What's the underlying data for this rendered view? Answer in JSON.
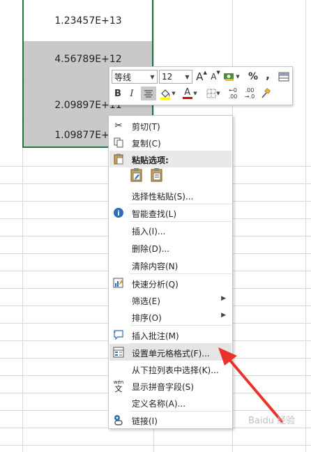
{
  "cells": [
    "1.23457E+13",
    "4.56789E+12",
    "2.09897E+11",
    "1.09877E+10"
  ],
  "toolbar": {
    "font_name": "等线",
    "font_size": "12",
    "grow_font": "A",
    "shrink_font": "A",
    "percent": "%",
    "comma": ",",
    "bold": "B",
    "italic": "I",
    "font_color_letter": "A",
    "decrease_decimal_top": "←0",
    "decrease_decimal_bottom": ".00",
    "increase_decimal_top": ".00",
    "increase_decimal_bottom": "→.0"
  },
  "menu": {
    "cut": "剪切(T)",
    "copy": "复制(C)",
    "paste_options": "粘贴选项:",
    "paste_special": "选择性粘贴(S)...",
    "smart_lookup": "智能查找(L)",
    "insert": "插入(I)...",
    "delete": "删除(D)...",
    "clear_contents": "清除内容(N)",
    "quick_analysis": "快速分析(Q)",
    "filter": "筛选(E)",
    "sort": "排序(O)",
    "insert_comment": "插入批注(M)",
    "format_cells": "设置单元格格式(F)...",
    "pick_from_list": "从下拉列表中选择(K)...",
    "phonetic": "显示拼音字段(S)",
    "define_name": "定义名称(A)...",
    "link": "链接(I)"
  },
  "colors": {
    "selection_border": "#217346",
    "selected_fill": "#c9c9c9",
    "font_color_bar": "#e00000",
    "fill_color_bar": "#ffff00",
    "arrow": "#e8322b"
  },
  "watermark": "Baidu 经验"
}
